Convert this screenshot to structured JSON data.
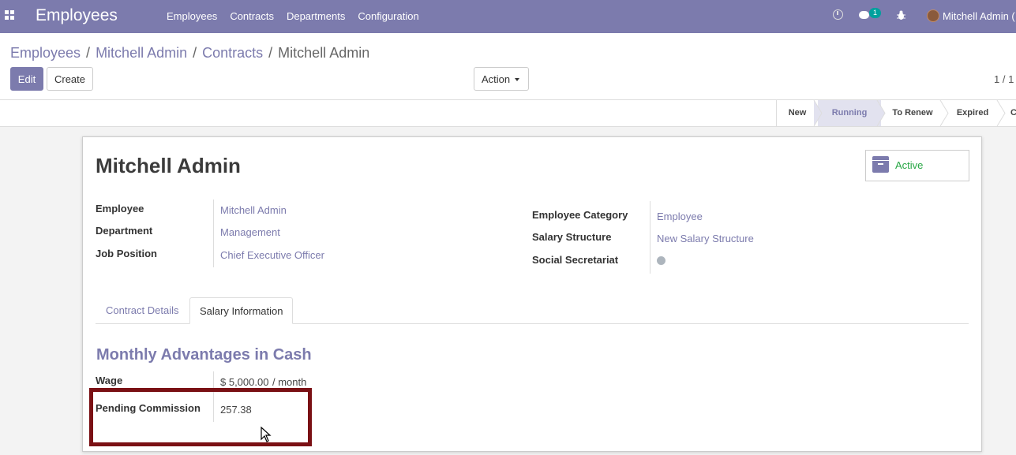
{
  "navbar": {
    "app_title": "Employees",
    "menu": [
      "Employees",
      "Contracts",
      "Departments",
      "Configuration"
    ],
    "message_count": "1",
    "user_name": "Mitchell Admin ("
  },
  "breadcrumb": {
    "items": [
      "Employees",
      "Mitchell Admin",
      "Contracts"
    ],
    "current": "Mitchell Admin",
    "separator": "/"
  },
  "toolbar": {
    "edit_label": "Edit",
    "create_label": "Create",
    "action_label": "Action",
    "pager": "1 / 1"
  },
  "statusbar": {
    "stages": [
      "New",
      "Running",
      "To Renew",
      "Expired",
      "C"
    ],
    "active_stage": "Running"
  },
  "form": {
    "title": "Mitchell Admin",
    "archive_status": "Active",
    "left_fields": [
      {
        "label": "Employee",
        "value": "Mitchell Admin"
      },
      {
        "label": "Department",
        "value": "Management"
      },
      {
        "label": "Job Position",
        "value": "Chief Executive Officer"
      }
    ],
    "right_fields": [
      {
        "label": "Employee Category",
        "value": "Employee"
      },
      {
        "label": "Salary Structure",
        "value": "New Salary Structure"
      },
      {
        "label": "Social Secretariat",
        "value": ""
      }
    ],
    "tabs": [
      "Contract Details",
      "Salary Information"
    ],
    "selected_tab": "Salary Information",
    "section_title": "Monthly Advantages in Cash",
    "wage": {
      "label": "Wage",
      "value": "$ 5,000.00",
      "unit": "/ month"
    },
    "pending_commission": {
      "label": "Pending Commission",
      "value": "257.38"
    }
  },
  "colors": {
    "brand": "#7c7bad",
    "active_green": "#28a745",
    "highlight_box": "#7a1014"
  }
}
